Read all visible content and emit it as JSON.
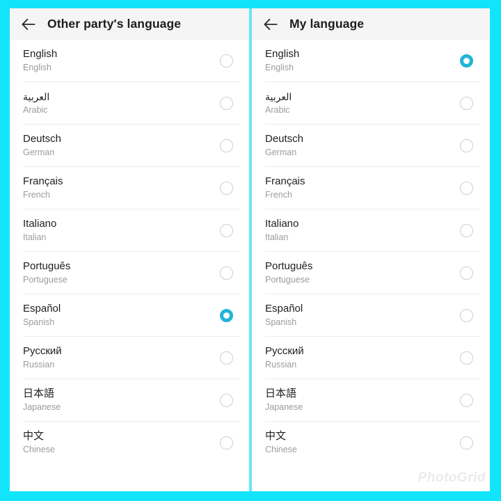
{
  "frame": {
    "accent_color": "#12e4fb",
    "divider_color": "#66e6f7"
  },
  "watermark": {
    "text": "PhotoGrid"
  },
  "panels": [
    {
      "id": "other-party-language",
      "title": "Other party's language",
      "back_icon": "back-arrow-icon",
      "selected_index": 6,
      "items": [
        {
          "native": "English",
          "english": "English",
          "rtl": false,
          "selected": false
        },
        {
          "native": "العربية",
          "english": "Arabic",
          "rtl": true,
          "selected": false
        },
        {
          "native": "Deutsch",
          "english": "German",
          "rtl": false,
          "selected": false
        },
        {
          "native": "Français",
          "english": "French",
          "rtl": false,
          "selected": false
        },
        {
          "native": "Italiano",
          "english": "Italian",
          "rtl": false,
          "selected": false
        },
        {
          "native": "Português",
          "english": "Portuguese",
          "rtl": false,
          "selected": false
        },
        {
          "native": "Español",
          "english": "Spanish",
          "rtl": false,
          "selected": true
        },
        {
          "native": "Русский",
          "english": "Russian",
          "rtl": false,
          "selected": false
        },
        {
          "native": "日本語",
          "english": "Japanese",
          "rtl": false,
          "selected": false
        },
        {
          "native": "中文",
          "english": "Chinese",
          "rtl": false,
          "selected": false
        }
      ]
    },
    {
      "id": "my-language",
      "title": "My language",
      "back_icon": "back-arrow-icon",
      "selected_index": 0,
      "items": [
        {
          "native": "English",
          "english": "English",
          "rtl": false,
          "selected": true
        },
        {
          "native": "العربية",
          "english": "Arabic",
          "rtl": true,
          "selected": false
        },
        {
          "native": "Deutsch",
          "english": "German",
          "rtl": false,
          "selected": false
        },
        {
          "native": "Français",
          "english": "French",
          "rtl": false,
          "selected": false
        },
        {
          "native": "Italiano",
          "english": "Italian",
          "rtl": false,
          "selected": false
        },
        {
          "native": "Português",
          "english": "Portuguese",
          "rtl": false,
          "selected": false
        },
        {
          "native": "Español",
          "english": "Spanish",
          "rtl": false,
          "selected": false
        },
        {
          "native": "Русский",
          "english": "Russian",
          "rtl": false,
          "selected": false
        },
        {
          "native": "日本語",
          "english": "Japanese",
          "rtl": false,
          "selected": false
        },
        {
          "native": "中文",
          "english": "Chinese",
          "rtl": false,
          "selected": false
        }
      ]
    }
  ]
}
